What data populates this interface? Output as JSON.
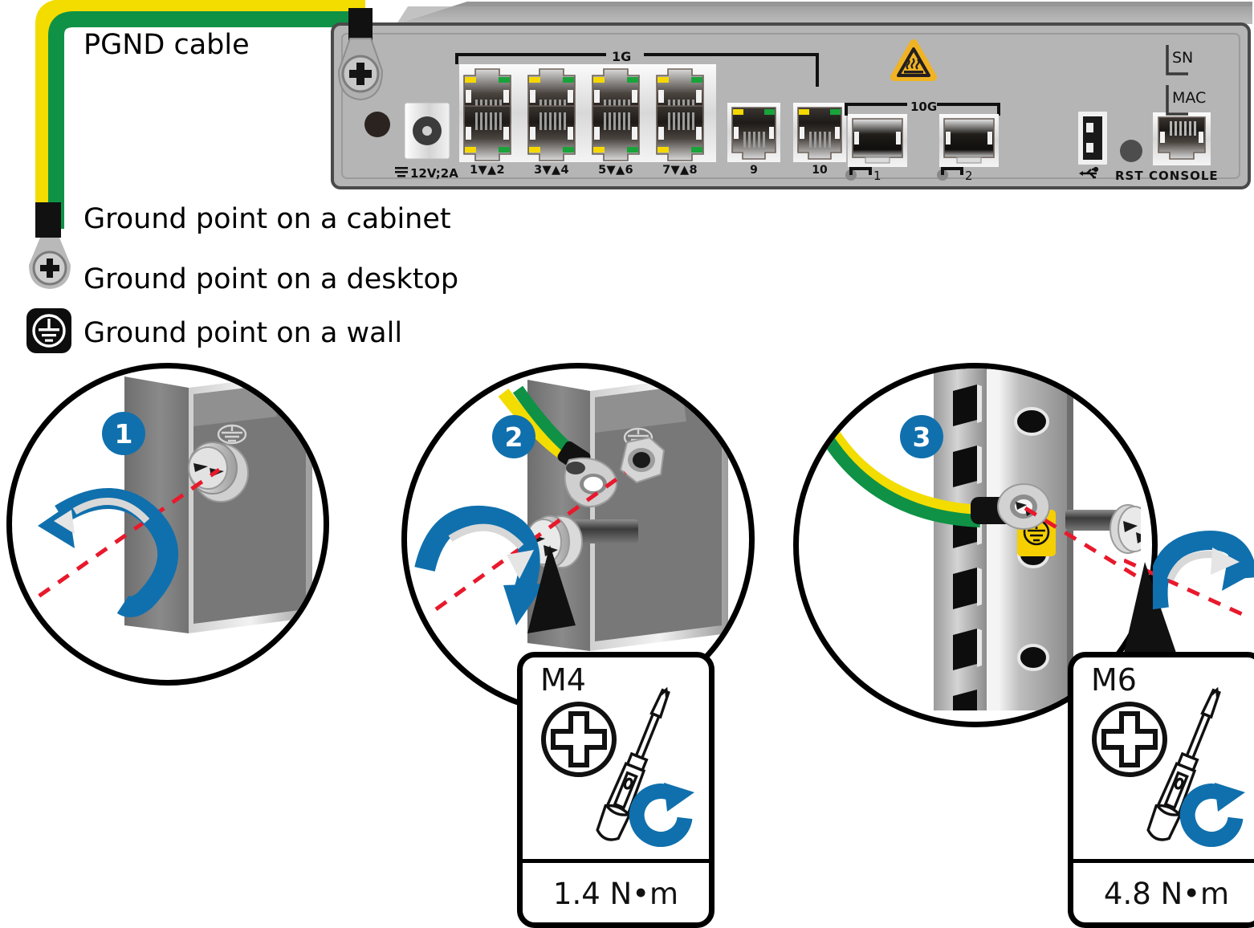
{
  "legend": {
    "pgnd_cable": "PGND cable",
    "items": [
      {
        "icon": "cable-lug-icon",
        "label": "Ground point on a cabinet"
      },
      {
        "icon": "screw-lug-icon",
        "label": "Ground point on a desktop"
      },
      {
        "icon": "earth-ground-icon",
        "label": "Ground point on a wall"
      }
    ]
  },
  "device": {
    "power_label": "12V;2A",
    "group_1g": "1G",
    "group_10g": "10G",
    "rj45_port_labels": [
      "1▼▲2",
      "3▼▲4",
      "5▼▲6",
      "7▼▲8"
    ],
    "single_port_labels": [
      "9",
      "10"
    ],
    "sfp_port_labels": [
      "1",
      "2"
    ],
    "usb_label": "",
    "rst_label": "RST",
    "console_label": "CONSOLE",
    "sn_label": "SN",
    "mac_label": "MAC",
    "warning_icon": "hot-surface-warning-icon"
  },
  "steps": [
    {
      "number": "1",
      "name": "remove-ground-screw"
    },
    {
      "number": "2",
      "name": "attach-lug-to-desktop"
    },
    {
      "number": "3",
      "name": "attach-lug-to-cabinet-rail"
    }
  ],
  "torque_specs": [
    {
      "screw": "M4",
      "value": "1.4 N•m",
      "step": "2"
    },
    {
      "screw": "M6",
      "value": "4.8 N•m",
      "step": "3"
    }
  ],
  "colors": {
    "accent_blue": "#1070ad",
    "cable_green": "#0f9246",
    "cable_yellow": "#f3dc00",
    "warning_yellow": "#f0b323",
    "guide_red": "#e8192c",
    "chassis_grey": "#b5b5b5"
  }
}
